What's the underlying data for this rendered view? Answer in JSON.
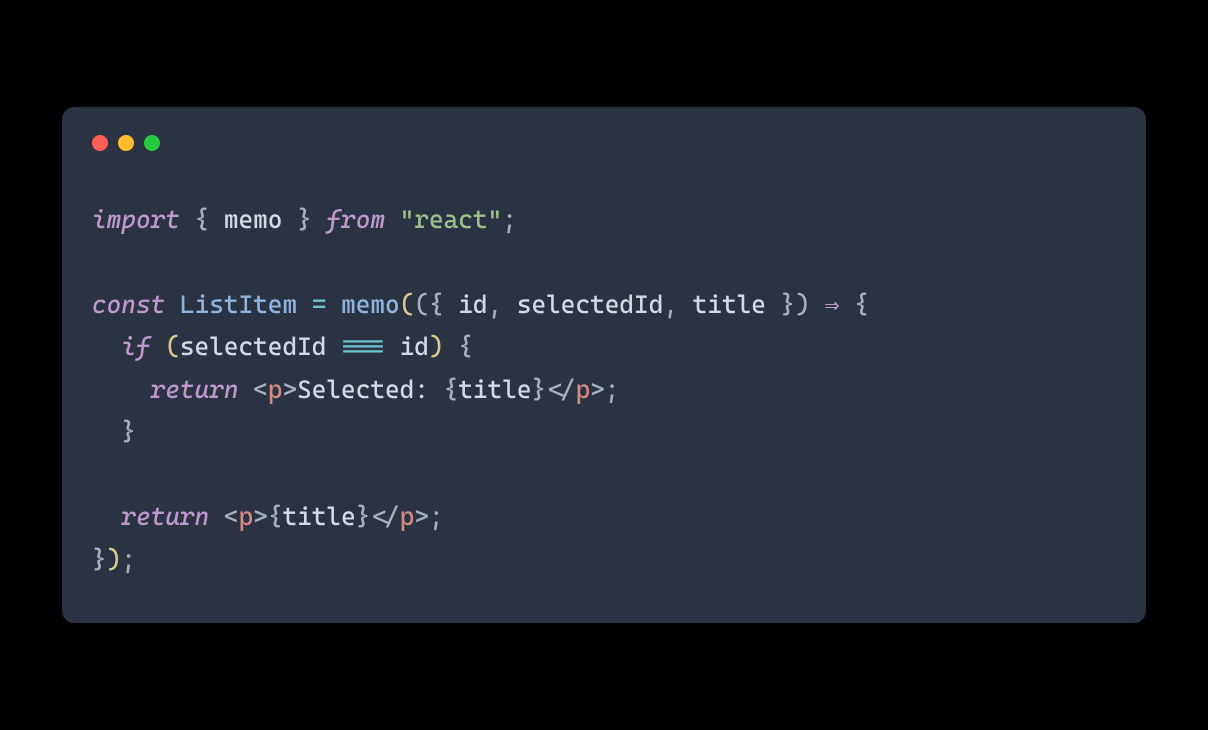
{
  "colors": {
    "red": "#ff5f56",
    "yellow": "#ffbd2e",
    "green": "#27c93f",
    "background": "#2b3342"
  },
  "code": {
    "l1": {
      "t1": "import",
      "t2": " { ",
      "t3": "memo",
      "t4": " } ",
      "t5": "from",
      "t6": " ",
      "t7": "\"react\"",
      "t8": ";"
    },
    "l3": {
      "t1": "const",
      "t2": " ",
      "t3": "ListItem",
      "t4": " ",
      "t5": "=",
      "t6": " ",
      "t7": "memo",
      "t8": "(",
      "t9": "(",
      "t10": "{ ",
      "t11": "id",
      "t12": ", ",
      "t13": "selectedId",
      "t14": ", ",
      "t15": "title",
      "t16": " }",
      "t17": ")",
      "t18": " ",
      "t19": "⇒",
      "t20": " ",
      "t21": "{"
    },
    "l4": {
      "t1": "  ",
      "t2": "if",
      "t3": " ",
      "t4": "(",
      "t5": "selectedId",
      "t6": " ",
      "t7": "===",
      "t8": " ",
      "t9": "id",
      "t10": ")",
      "t11": " ",
      "t12": "{"
    },
    "l5": {
      "t1": "    ",
      "t2": "return",
      "t3": " ",
      "t4": "<",
      "t5": "p",
      "t6": ">",
      "t7": "Selected: ",
      "t8": "{",
      "t9": "title",
      "t10": "}",
      "t11": "</",
      "t12": "p",
      "t13": ">",
      "t14": ";"
    },
    "l6": {
      "t1": "  ",
      "t2": "}"
    },
    "l8": {
      "t1": "  ",
      "t2": "return",
      "t3": " ",
      "t4": "<",
      "t5": "p",
      "t6": ">",
      "t7": "{",
      "t8": "title",
      "t9": "}",
      "t10": "</",
      "t11": "p",
      "t12": ">",
      "t13": ";"
    },
    "l9": {
      "t1": "}",
      "t2": ")",
      "t3": ";"
    }
  }
}
